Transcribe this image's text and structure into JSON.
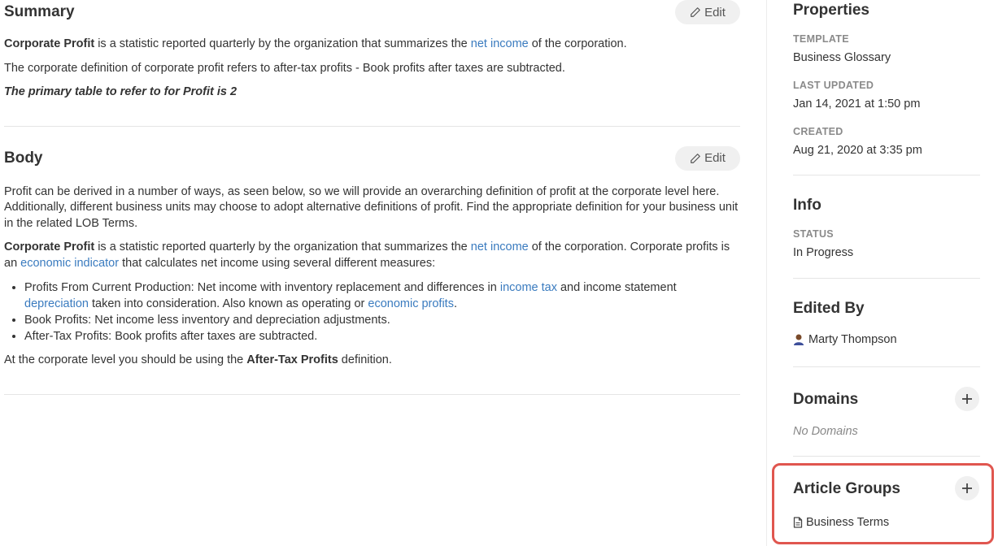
{
  "summary": {
    "title": "Summary",
    "edit_label": "Edit",
    "p1_bold": "Corporate Profit",
    "p1_text_a": " is a statistic reported quarterly by the organization that summarizes the ",
    "p1_link": "net income",
    "p1_text_b": " of the corporation.",
    "p2": "The corporate definition of corporate profit refers to after-tax profits - Book profits after taxes are subtracted.",
    "p3": "The primary table to refer to for Profit is 2"
  },
  "body": {
    "title": "Body",
    "edit_label": "Edit",
    "p1": "Profit can be derived in a number of ways, as seen below, so we will provide an overarching definition of profit at the corporate level here. Additionally, different business units may choose to adopt alternative definitions of profit. Find the appropriate definition for your business unit in the related LOB Terms.",
    "p2_bold": "Corporate Profit",
    "p2_text_a": " is a statistic reported quarterly by the organization that summarizes the ",
    "p2_link1": "net income",
    "p2_text_b": " of the corporation. Corporate profits is an ",
    "p2_link2": "economic indicator",
    "p2_text_c": " that calculates net income using several different measures:",
    "b1_text_a": "Profits From Current Production: Net income with inventory replacement and differences in ",
    "b1_link1": "income tax",
    "b1_text_b": " and income statement ",
    "b1_link2": "depreciation",
    "b1_text_c": " taken into consideration. Also known as operating or ",
    "b1_link3": "economic profits",
    "b1_text_d": ".",
    "b2": "Book Profits: Net income less inventory and depreciation adjustments.",
    "b3": "After-Tax Profits: Book profits after taxes are subtracted.",
    "p3_text_a": "At the corporate level you should be using the ",
    "p3_bold": "After-Tax Profits",
    "p3_text_b": " definition."
  },
  "properties": {
    "title": "Properties",
    "template_label": "TEMPLATE",
    "template_value": "Business Glossary",
    "updated_label": "LAST UPDATED",
    "updated_value": "Jan 14, 2021 at 1:50 pm",
    "created_label": "CREATED",
    "created_value": "Aug 21, 2020 at 3:35 pm"
  },
  "info": {
    "title": "Info",
    "status_label": "STATUS",
    "status_value": "In Progress"
  },
  "edited_by": {
    "title": "Edited By",
    "user": "Marty Thompson"
  },
  "domains": {
    "title": "Domains",
    "empty": "No Domains"
  },
  "article_groups": {
    "title": "Article Groups",
    "item": "Business Terms"
  },
  "colors": {
    "link": "#3a7bbf",
    "highlight": "#e0564f"
  }
}
